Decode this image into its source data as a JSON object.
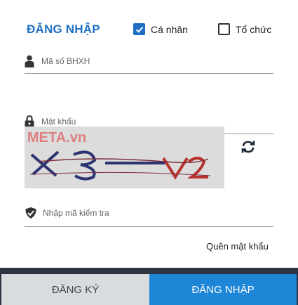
{
  "login_title": "ĐĂNG NHẬP",
  "account_type": {
    "personal": {
      "label": "Cá nhân",
      "checked": true
    },
    "organization": {
      "label": "Tổ chức",
      "checked": false
    }
  },
  "fields": {
    "social_insurance_id": {
      "placeholder": "Mã số BHXH",
      "icon": "user-icon"
    },
    "password": {
      "placeholder": "Mật khẩu",
      "icon": "lock-icon"
    },
    "captcha_input": {
      "placeholder": "Nhập mã kiểm tra",
      "icon": "shield-icon"
    }
  },
  "captcha": {
    "watermark": "META.vn",
    "refresh_icon": "refresh-icon"
  },
  "links": {
    "forgot_password": "Quên mật khẩu"
  },
  "buttons": {
    "register": "ĐĂNG KÝ",
    "login": "ĐĂNG NHẬP"
  },
  "colors": {
    "accent": "#1e6fc4",
    "login_button": "#1e86d6",
    "register_button": "#d8dcdf"
  }
}
